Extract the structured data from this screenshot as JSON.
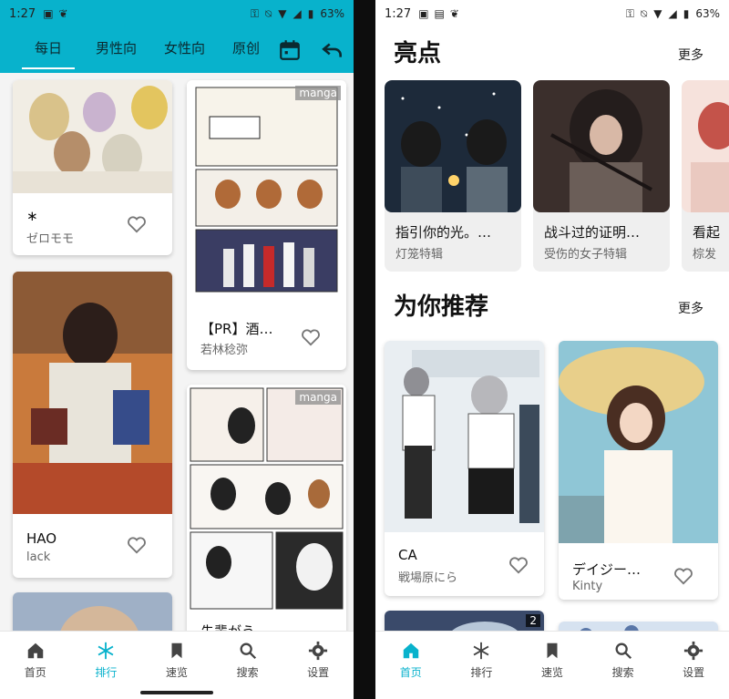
{
  "left_phone": {
    "status": {
      "time": "1:27",
      "battery": "63%"
    },
    "tabs": [
      "每日",
      "男性向",
      "女性向",
      "原创"
    ],
    "active_tab": 0,
    "cards": [
      {
        "title": "∗",
        "author": "ゼロモモ"
      },
      {
        "title": "HAO",
        "author": "lack"
      },
      {
        "title": "【PR】酒…",
        "author": "若林稔弥",
        "badge": "manga"
      },
      {
        "title": "先輩がう",
        "author": "",
        "badge": "manga"
      }
    ],
    "nav": [
      {
        "label": "首页",
        "icon": "home-icon"
      },
      {
        "label": "排行",
        "icon": "snowflake-icon"
      },
      {
        "label": "速览",
        "icon": "bookmark-icon"
      },
      {
        "label": "搜索",
        "icon": "search-icon"
      },
      {
        "label": "设置",
        "icon": "gear-icon"
      }
    ],
    "active_nav": 1
  },
  "right_phone": {
    "status": {
      "time": "1:27",
      "battery": "63%"
    },
    "highlights": {
      "title": "亮点",
      "more": "更多",
      "items": [
        {
          "title": "指引你的光。…",
          "author": "灯笼特辑"
        },
        {
          "title": "战斗过的证明…",
          "author": "受伤的女子特辑"
        },
        {
          "title": "看起",
          "author": "棕发"
        }
      ]
    },
    "recommend": {
      "title": "为你推荐",
      "more": "更多",
      "items": [
        {
          "title": "CA",
          "author": "戦場原にら"
        },
        {
          "title": "デイジー…",
          "author": "Kinty"
        },
        {
          "title": "",
          "author": "",
          "count": "2"
        }
      ]
    },
    "nav": [
      {
        "label": "首页",
        "icon": "home-icon"
      },
      {
        "label": "排行",
        "icon": "snowflake-icon"
      },
      {
        "label": "速览",
        "icon": "bookmark-icon"
      },
      {
        "label": "搜索",
        "icon": "search-icon"
      },
      {
        "label": "设置",
        "icon": "gear-icon"
      }
    ],
    "active_nav": 0
  },
  "colors": {
    "accent": "#08b2cc"
  }
}
